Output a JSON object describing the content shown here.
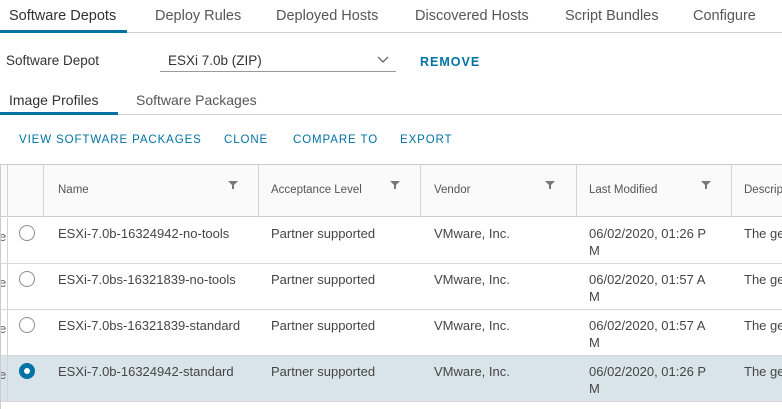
{
  "top_tabs": [
    {
      "label": "Software Depots",
      "active": true
    },
    {
      "label": "Deploy Rules",
      "active": false
    },
    {
      "label": "Deployed Hosts",
      "active": false
    },
    {
      "label": "Discovered Hosts",
      "active": false
    },
    {
      "label": "Script Bundles",
      "active": false
    },
    {
      "label": "Configure",
      "active": false
    }
  ],
  "depot": {
    "label": "Software Depot",
    "selected_value": "ESXi 7.0b (ZIP)",
    "remove_label": "REMOVE"
  },
  "sub_tabs": [
    {
      "label": "Image Profiles",
      "active": true
    },
    {
      "label": "Software Packages",
      "active": false
    }
  ],
  "actions": {
    "view_packages": "VIEW SOFTWARE PACKAGES",
    "clone": "CLONE",
    "compare": "COMPARE TO",
    "export": "EXPORT"
  },
  "grid": {
    "columns": [
      "Name",
      "Acceptance Level",
      "Vendor",
      "Last Modified",
      "Descrip"
    ],
    "edge_letter": "e",
    "rows": [
      {
        "name": "ESXi-7.0b-16324942-no-tools",
        "acceptance": "Partner supported",
        "vendor": "VMware, Inc.",
        "modified_1": "06/02/2020, 01:26 P",
        "modified_2": "M",
        "description": "The ge",
        "selected": false
      },
      {
        "name": "ESXi-7.0bs-16321839-no-tools",
        "acceptance": "Partner supported",
        "vendor": "VMware, Inc.",
        "modified_1": "06/02/2020, 01:57 A",
        "modified_2": "M",
        "description": "The ge",
        "selected": false
      },
      {
        "name": "ESXi-7.0bs-16321839-standard",
        "acceptance": "Partner supported",
        "vendor": "VMware, Inc.",
        "modified_1": "06/02/2020, 01:57 A",
        "modified_2": "M",
        "description": "The ge",
        "selected": false
      },
      {
        "name": "ESXi-7.0b-16324942-standard",
        "acceptance": "Partner supported",
        "vendor": "VMware, Inc.",
        "modified_1": "06/02/2020, 01:26 P",
        "modified_2": "M",
        "description": "The ge",
        "selected": true
      }
    ]
  },
  "colors": {
    "accent": "#0072a3",
    "selected_row": "#d9e4ea"
  }
}
